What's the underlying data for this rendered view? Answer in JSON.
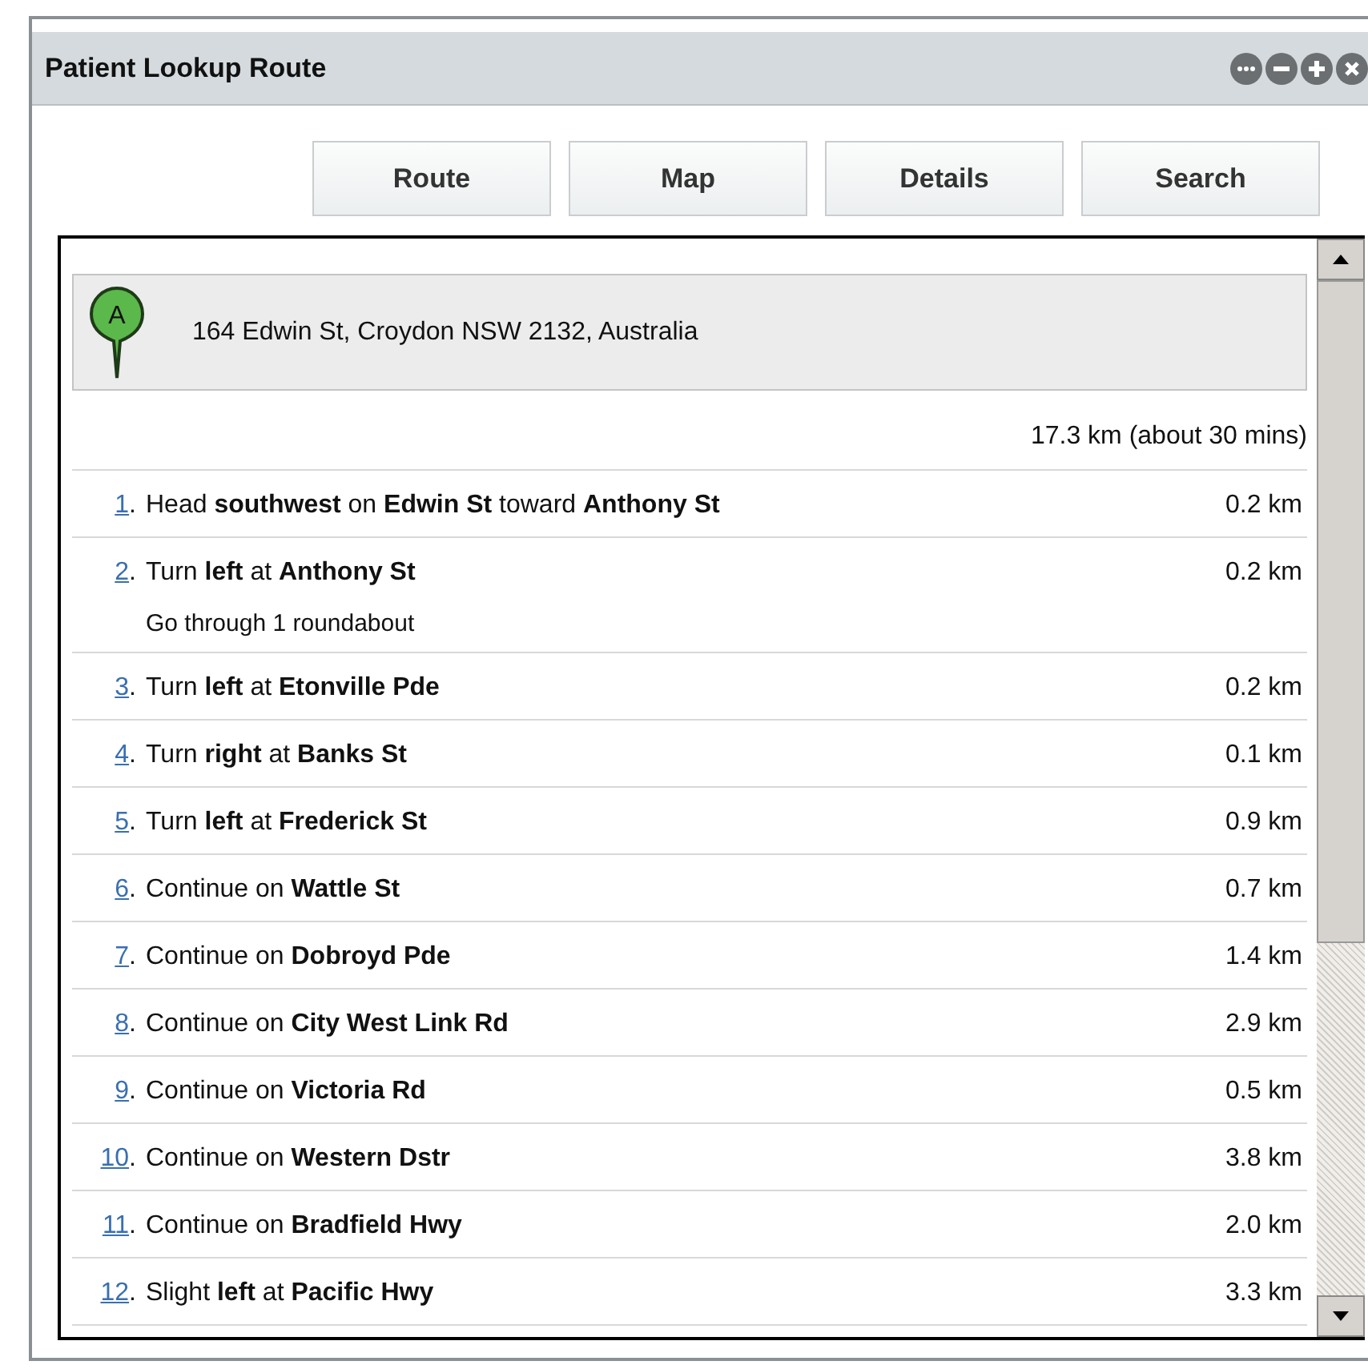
{
  "window": {
    "title": "Patient Lookup Route"
  },
  "tabs": [
    {
      "label": "Route"
    },
    {
      "label": "Map"
    },
    {
      "label": "Details"
    },
    {
      "label": "Search"
    }
  ],
  "start": {
    "marker": "A",
    "address": "164 Edwin St, Croydon NSW 2132, Australia"
  },
  "total": "17.3 km (about 30 mins)",
  "steps": [
    {
      "number": "1",
      "suffix": ".",
      "text": "Head **southwest** on **Edwin St** toward **Anthony St**",
      "distance": "0.2 km"
    },
    {
      "number": "2",
      "suffix": ".",
      "text": "Turn **left** at **Anthony St**",
      "note": "Go through 1 roundabout",
      "distance": "0.2 km"
    },
    {
      "number": "3",
      "suffix": ".",
      "text": "Turn **left** at **Etonville Pde**",
      "distance": "0.2 km"
    },
    {
      "number": "4",
      "suffix": ".",
      "text": "Turn **right** at **Banks St**",
      "distance": "0.1 km"
    },
    {
      "number": "5",
      "suffix": ".",
      "text": "Turn **left** at **Frederick St**",
      "distance": "0.9 km"
    },
    {
      "number": "6",
      "suffix": ".",
      "text": "Continue on **Wattle St**",
      "distance": "0.7 km"
    },
    {
      "number": "7",
      "suffix": ".",
      "text": "Continue on **Dobroyd Pde**",
      "distance": "1.4 km"
    },
    {
      "number": "8",
      "suffix": ".",
      "text": "Continue on **City West Link Rd**",
      "distance": "2.9 km"
    },
    {
      "number": "9",
      "suffix": ".",
      "text": "Continue on **Victoria Rd**",
      "distance": "0.5 km"
    },
    {
      "number": "10",
      "suffix": ".",
      "text": "Continue on **Western Dstr**",
      "distance": "3.8 km"
    },
    {
      "number": "11",
      "suffix": ".",
      "text": "Continue on **Bradfield Hwy**",
      "distance": "2.0 km"
    },
    {
      "number": "12",
      "suffix": ".",
      "text": "Slight **left** at **Pacific Hwy**",
      "distance": "3.3 km"
    }
  ]
}
